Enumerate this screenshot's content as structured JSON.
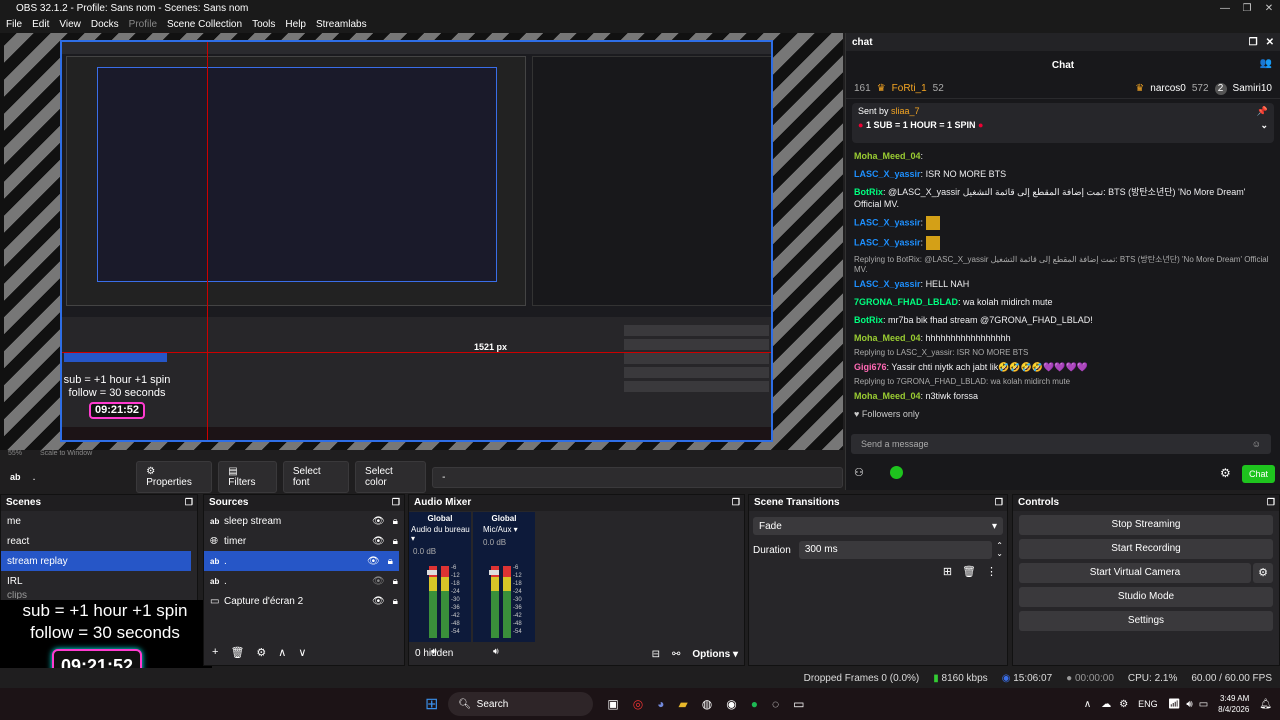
{
  "window": {
    "title": "OBS 32.1.2 - Profile: Sans nom - Scenes: Sans nom"
  },
  "menu": [
    "File",
    "Edit",
    "View",
    "Docks",
    "Profile",
    "Scene Collection",
    "Tools",
    "Help",
    "Streamlabs"
  ],
  "preview": {
    "zoom": "55%",
    "scale": "Scale to Window"
  },
  "nested": {
    "sub_text": "sub = +1 hour +1 spin",
    "follow_text": "follow = 30 seconds",
    "timer": "09:21:52",
    "px_readout": "1521 px"
  },
  "chat": {
    "dock_title": "chat",
    "title": "Chat",
    "leaderboard": [
      {
        "rank": "161",
        "name": "FoRti_1",
        "score": "52"
      },
      {
        "rank": "",
        "name": "narcos0",
        "score": "572"
      },
      {
        "rank": "2",
        "name": "Samiri10",
        "score": ""
      }
    ],
    "pinned_sent_by": "Sent by",
    "pinned_user": "sliaa_7",
    "pinned_text": "1 SUB = 1 HOUR = 1 SPIN",
    "messages": [
      {
        "user": "Moha_Meed_04",
        "text": "",
        "color": "#9acd32"
      },
      {
        "user": "LASC_X_yassir",
        "text": "ISR NO MORE BTS",
        "color": "#1e90ff"
      },
      {
        "user": "BotRix",
        "text": "@LASC_X_yassir تمت إضافة المقطع إلى قائمة التشغيل: BTS (방탄소년단) 'No More Dream' Official MV.",
        "color": "#00ff7f"
      },
      {
        "user": "LASC_X_yassir",
        "text": "",
        "color": "#1e90ff"
      },
      {
        "user": "LASC_X_yassir",
        "text": "",
        "color": "#1e90ff"
      }
    ],
    "reply1": "Replying to BotRix: @LASC_X_yassir تمت إضافة المقطع إلى قائمة التشغيل: BTS (방탄소년단) 'No More Dream' Official MV.",
    "messages2": [
      {
        "user": "LASC_X_yassir",
        "text": "HELL NAH",
        "color": "#1e90ff"
      },
      {
        "user": "7GRONA_FHAD_LBLAD",
        "text": "wa kolah midirch mute",
        "color": "#00ff7f"
      },
      {
        "user": "BotRix",
        "text": "mr7ba bik fhad stream @7GRONA_FHAD_LBLAD!",
        "color": "#00ff7f"
      },
      {
        "user": "Moha_Meed_04",
        "text": "hhhhhhhhhhhhhhhhh",
        "color": "#9acd32"
      }
    ],
    "reply2": "Replying to LASC_X_yassir: ISR NO MORE BTS",
    "messages3": [
      {
        "user": "Gigi676",
        "text": "Yassir chti niytk ach jabt lik🤣🤣🤣🤣💜💜💜💜",
        "color": "#ff69b4"
      }
    ],
    "reply3": "Replying to 7GRONA_FHAD_LBLAD: wa kolah midirch mute",
    "messages4": [
      {
        "user": "Moha_Meed_04",
        "text": "n3tiwk forssa",
        "color": "#9acd32"
      }
    ],
    "followers_only": "Followers only",
    "send_placeholder": "Send a message",
    "chat_button": "Chat"
  },
  "toolbar": {
    "source_name": ".",
    "properties": "Properties",
    "filters": "Filters",
    "select_font": "Select font",
    "select_color": "Select color",
    "dash": "-"
  },
  "scenes": {
    "title": "Scenes",
    "items": [
      "me",
      "react",
      "stream replay",
      "IRL",
      "clips"
    ],
    "selected": 2
  },
  "overlay": {
    "sub_text": "sub  = +1 hour +1 spin",
    "follow_text": "follow = 30 seconds",
    "timer": "09:21:52"
  },
  "sources": {
    "title": "Sources",
    "items": [
      {
        "name": "sleep stream",
        "icon": "text-icon"
      },
      {
        "name": "timer",
        "icon": "browser-icon"
      },
      {
        "name": ".",
        "icon": "text-icon"
      },
      {
        "name": ".",
        "icon": "text-icon"
      },
      {
        "name": "Capture d'écran 2",
        "icon": "monitor-icon"
      }
    ],
    "selected": 2
  },
  "mixer": {
    "title": "Audio Mixer",
    "channels": [
      {
        "global": "Global",
        "name": "Audio du bureau",
        "db": "0.0 dB"
      },
      {
        "global": "Global",
        "name": "Mic/Aux",
        "db": "0.0 dB"
      }
    ],
    "scale": [
      "-6",
      "-12",
      "-18",
      "-24",
      "-30",
      "-36",
      "-42",
      "-48",
      "-54",
      "-60"
    ],
    "hidden": "0 hidden",
    "options": "Options"
  },
  "transitions": {
    "title": "Scene Transitions",
    "selected": "Fade",
    "duration_label": "Duration",
    "duration": "300 ms"
  },
  "controls": {
    "title": "Controls",
    "buttons": [
      "Stop Streaming",
      "Start Recording",
      "Start Virtual Camera",
      "Studio Mode",
      "Settings"
    ]
  },
  "status": {
    "dropped": "Dropped Frames 0 (0.0%)",
    "kbps": "8160 kbps",
    "stream_time": "15:06:07",
    "rec_time": "00:00:00",
    "cpu": "CPU: 2.1%",
    "fps": "60.00 / 60.00 FPS"
  },
  "taskbar": {
    "search": "Search",
    "lang": "ENG",
    "time": "3:49 AM",
    "date": "8/4/2026"
  },
  "colors": {
    "accent": "#2656c7",
    "chat_green": "#1ec41e",
    "live_red": "#e00000"
  }
}
